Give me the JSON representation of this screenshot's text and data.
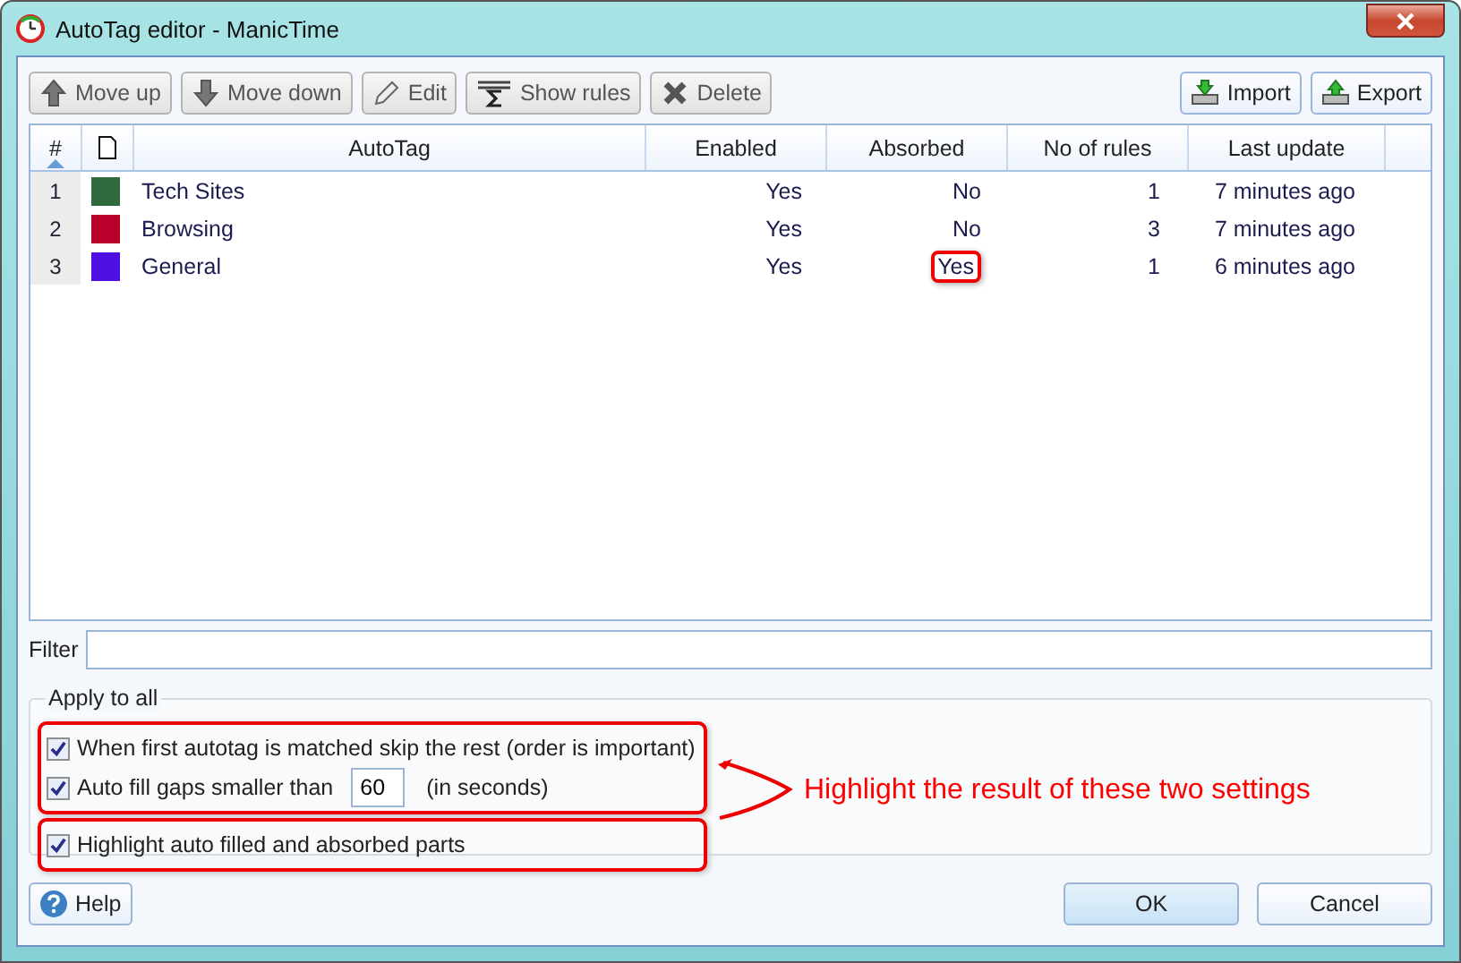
{
  "window": {
    "title": "AutoTag editor - ManicTime"
  },
  "toolbar": [
    {
      "label": "Move up",
      "kind": "up"
    },
    {
      "label": "Move down",
      "kind": "down"
    },
    {
      "label": "Edit",
      "kind": "edit"
    },
    {
      "label": "Show rules",
      "kind": "rules"
    },
    {
      "label": "Delete",
      "kind": "delete"
    }
  ],
  "toolbar_right": [
    {
      "label": "Import",
      "kind": "import"
    },
    {
      "label": "Export",
      "kind": "export"
    }
  ],
  "table": {
    "columns": [
      "#",
      "AutoTag",
      "Enabled",
      "Absorbed",
      "No of rules",
      "Last update"
    ],
    "rows": [
      {
        "num": "1",
        "color": "#2f6b3f",
        "name": "Tech Sites",
        "enabled": "Yes",
        "absorbed": "No",
        "absorbed_circled": false,
        "rules": "1",
        "updated": "7 minutes ago"
      },
      {
        "num": "2",
        "color": "#b8002a",
        "name": "Browsing",
        "enabled": "Yes",
        "absorbed": "No",
        "absorbed_circled": false,
        "rules": "3",
        "updated": "7 minutes ago"
      },
      {
        "num": "3",
        "color": "#4d10e0",
        "name": "General",
        "enabled": "Yes",
        "absorbed": "Yes",
        "absorbed_circled": true,
        "rules": "1",
        "updated": "6 minutes ago"
      }
    ]
  },
  "filter": {
    "label": "Filter"
  },
  "apply_to_all": {
    "title": "Apply to all",
    "groups": [
      {
        "circled": true,
        "options": [
          {
            "kind": "checkbox",
            "label": "When first autotag is matched skip the rest (order is important)",
            "checked": true
          },
          {
            "kind": "number",
            "label": "Auto fill gaps smaller than",
            "value": "60",
            "suffix": "(in seconds)",
            "checked": true
          }
        ]
      },
      {
        "circled": true,
        "options": [
          {
            "kind": "checkbox",
            "label": "Highlight auto filled and absorbed parts",
            "checked": true
          }
        ]
      }
    ],
    "callout": "Highlight the result of these two settings"
  },
  "buttons": {
    "help": "Help",
    "ok": "OK",
    "cancel": "Cancel"
  }
}
